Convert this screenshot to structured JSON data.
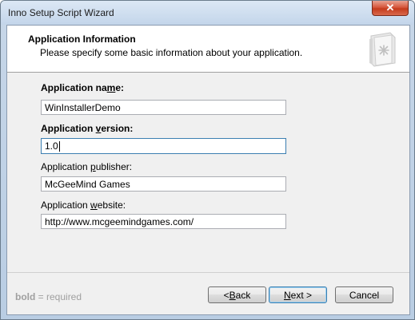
{
  "window": {
    "title": "Inno Setup Script Wizard",
    "close_glyph": "✕"
  },
  "header": {
    "title": "Application Information",
    "subtitle": "Please specify some basic information about your application.",
    "icon": "wizard-page-icon"
  },
  "form": {
    "name_label_pre": "Application na",
    "name_label_key": "m",
    "name_label_post": "e:",
    "name_value": "WinInstallerDemo",
    "version_label_pre": "Application ",
    "version_label_key": "v",
    "version_label_post": "ersion:",
    "version_value": "1.0",
    "publisher_label_pre": "Application ",
    "publisher_label_key": "p",
    "publisher_label_post": "ublisher:",
    "publisher_value": "McGeeMind Games",
    "website_label_pre": "Application ",
    "website_label_key": "w",
    "website_label_post": "ebsite:",
    "website_value": "http://www.mcgeemindgames.com/"
  },
  "footer": {
    "legend_bold": "bold",
    "legend_rest": " = required",
    "back_pre": "< ",
    "back_key": "B",
    "back_post": "ack",
    "next_key": "N",
    "next_post": "ext >",
    "cancel": "Cancel"
  },
  "colors": {
    "focus_border": "#3c7fb1",
    "close_button": "#c43b1d"
  }
}
